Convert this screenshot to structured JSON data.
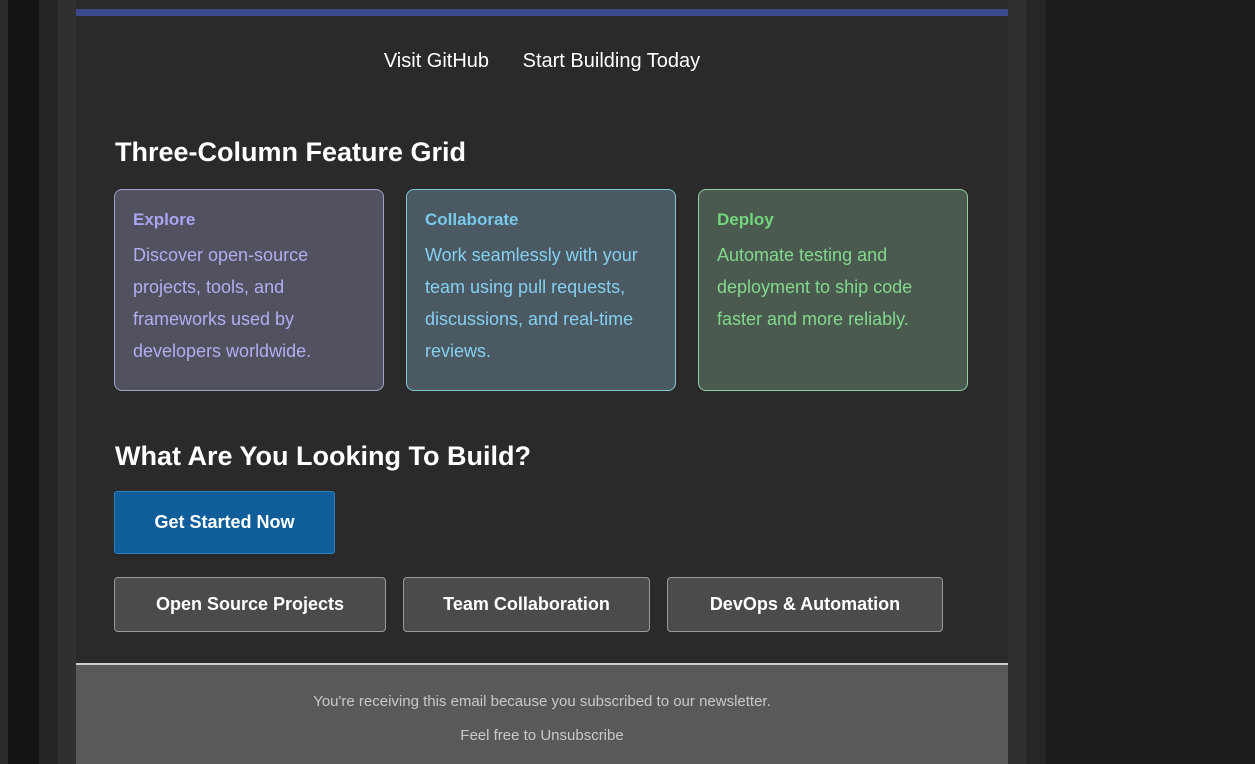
{
  "header": {
    "links": [
      {
        "label": "Visit GitHub"
      },
      {
        "label": "Start Building Today"
      }
    ]
  },
  "feature_grid": {
    "heading": "Three-Column Feature Grid",
    "cards": [
      {
        "title": "Explore",
        "body": "Discover open-source projects, tools, and frameworks used by developers worldwide."
      },
      {
        "title": "Collaborate",
        "body": "Work seamlessly with your team using pull requests, discussions, and real-time reviews."
      },
      {
        "title": "Deploy",
        "body": "Automate testing and deployment to ship code faster and more reliably."
      }
    ]
  },
  "build_section": {
    "heading": "What Are You Looking To Build?",
    "primary_button": "Get Started Now",
    "options": [
      {
        "label": "Open Source Projects"
      },
      {
        "label": "Team Collaboration"
      },
      {
        "label": "DevOps & Automation"
      }
    ]
  },
  "footer": {
    "notice": "You're receiving this email because you subscribed to our newsletter.",
    "prefix": "Feel free to ",
    "unsubscribe_label": "Unsubscribe"
  },
  "colors": {
    "accent_bar": "#3c4a8c",
    "primary_button": "#0f5e9a",
    "explore": "#a9a5f2",
    "collaborate": "#79c9ec",
    "deploy": "#72d67f"
  }
}
